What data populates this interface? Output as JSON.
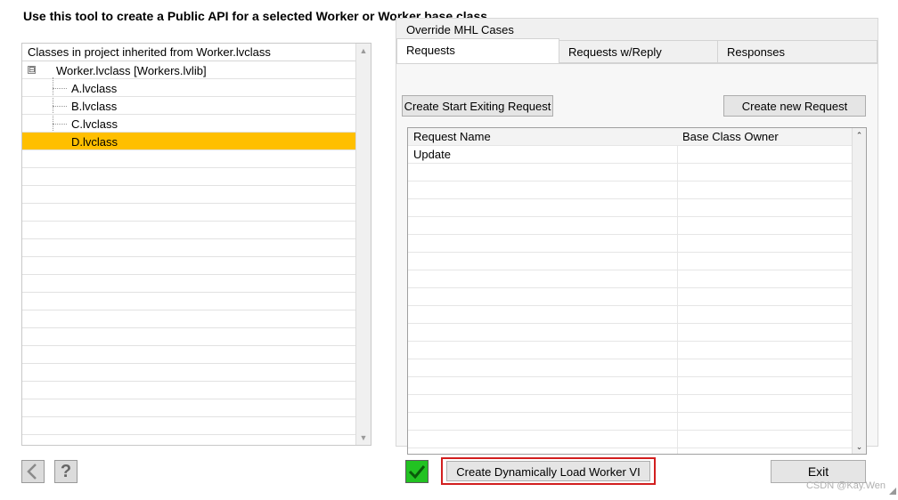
{
  "page_title": "Use this tool to create a Public API for a selected Worker or Worker base class",
  "tree": {
    "header": "Classes in project inherited from Worker.lvclass",
    "root": {
      "label": "Worker.lvclass  [Workers.lvlib]",
      "expander": "⊟"
    },
    "children": [
      {
        "label": "A.lvclass"
      },
      {
        "label": "B.lvclass"
      },
      {
        "label": "C.lvclass"
      },
      {
        "label": "D.lvclass"
      }
    ],
    "selected": "D.lvclass",
    "selected_color": "#ffbf00"
  },
  "right_panel": {
    "title": "Override MHL Cases",
    "tabs": [
      "Requests",
      "Requests w/Reply",
      "Responses"
    ],
    "active_tab": "Requests",
    "buttons": {
      "create_start_exiting": "Create Start Exiting Request",
      "create_new_request": "Create new Request"
    },
    "table": {
      "columns": [
        "Request Name",
        "Base Class Owner"
      ],
      "rows": [
        [
          "Update",
          ""
        ]
      ]
    }
  },
  "bottom": {
    "back_icon": "back-arrow-icon",
    "help_icon": "question-mark-icon",
    "help_glyph": "?",
    "check_icon": "checkmark-icon",
    "check_color": "#22c222",
    "create_dynamic_button": "Create Dynamically Load Worker VI",
    "highlight_color": "#d21f1f",
    "exit_button": "Exit"
  },
  "watermark": "CSDN @Kay.Wen"
}
